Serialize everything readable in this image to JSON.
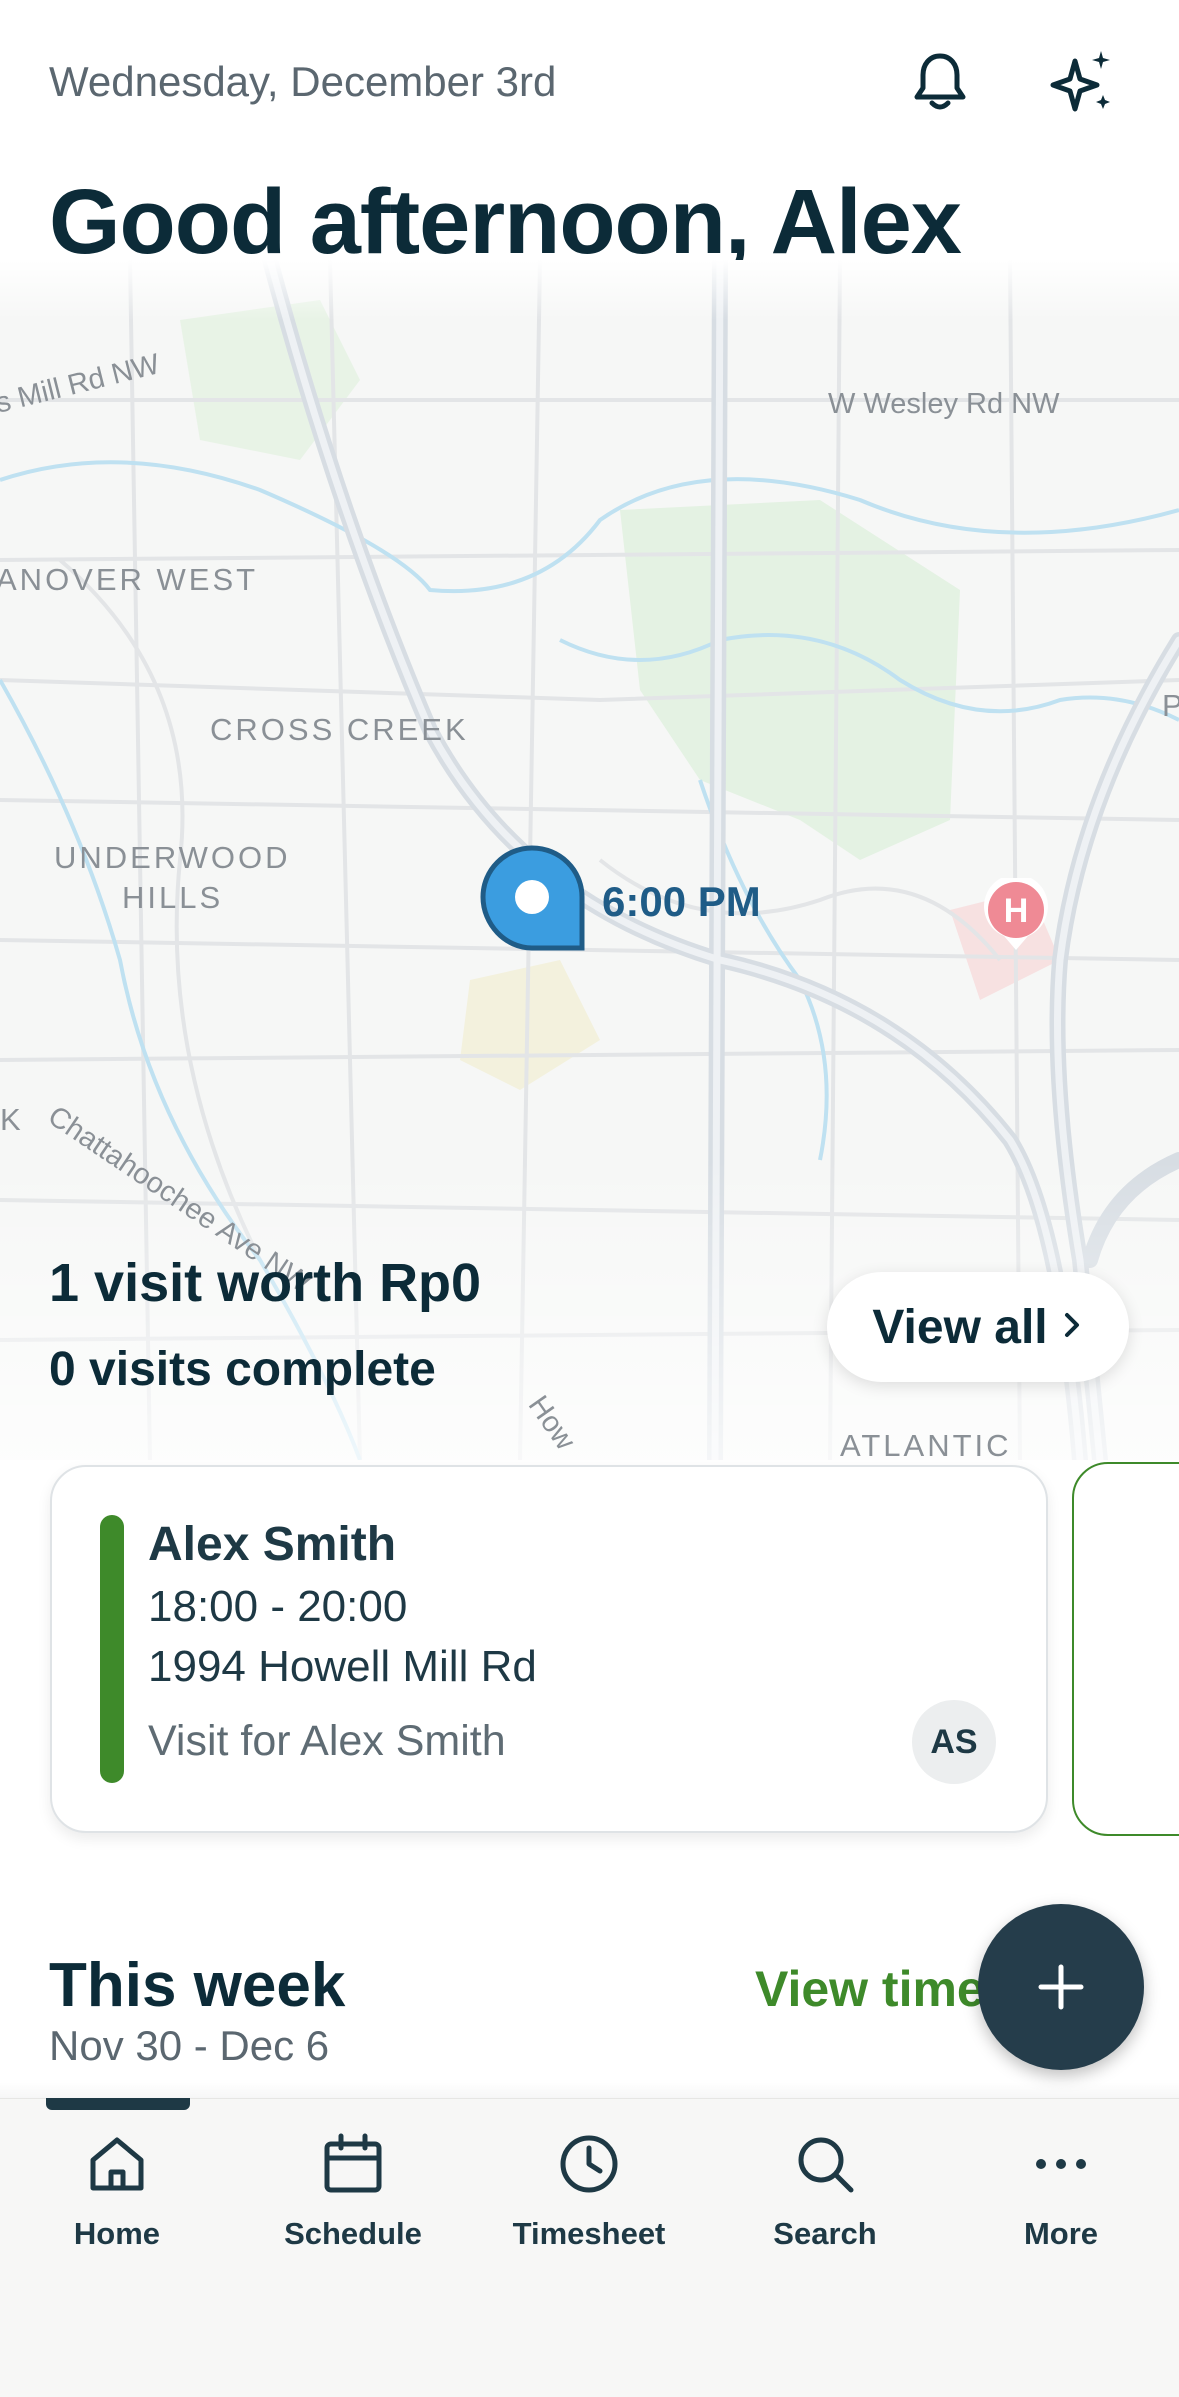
{
  "header": {
    "date": "Wednesday, December 3rd",
    "greeting": "Good afternoon, Alex",
    "icons": [
      "bell-icon",
      "sparkle-icon"
    ]
  },
  "map": {
    "area_labels": [
      "ANOVER WEST",
      "CROSS CREEK",
      "UNDERWOOD",
      "HILLS",
      "ATLANTIC",
      "K",
      "P"
    ],
    "street_labels": [
      "s Mill Rd NW",
      "W Wesley Rd NW",
      "Chattahoochee Ave NW",
      "How"
    ],
    "pin_time": "6:00 PM",
    "hospital_label": "H"
  },
  "summary": {
    "visits_worth": "1 visit worth Rp0",
    "visits_complete": "0 visits complete",
    "view_all": "View all"
  },
  "visit_card": {
    "name": "Alex Smith",
    "time": "18:00 - 20:00",
    "address": "1994 Howell Mill Rd",
    "description": "Visit for Alex Smith",
    "initials": "AS",
    "accent_color": "#3e8a2a"
  },
  "week": {
    "title": "This week",
    "range": "Nov 30 - Dec 6",
    "view_timesheet": "View time"
  },
  "nav": {
    "items": [
      {
        "label": "Home",
        "icon": "home-icon"
      },
      {
        "label": "Schedule",
        "icon": "calendar-icon"
      },
      {
        "label": "Timesheet",
        "icon": "clock-icon"
      },
      {
        "label": "Search",
        "icon": "search-icon"
      },
      {
        "label": "More",
        "icon": "more-icon"
      }
    ],
    "active": "Home"
  },
  "colors": {
    "primary_dark": "#0c2b38",
    "accent_green": "#3e8a2a",
    "pin_blue": "#3b9de0",
    "fab": "#253d4b"
  }
}
